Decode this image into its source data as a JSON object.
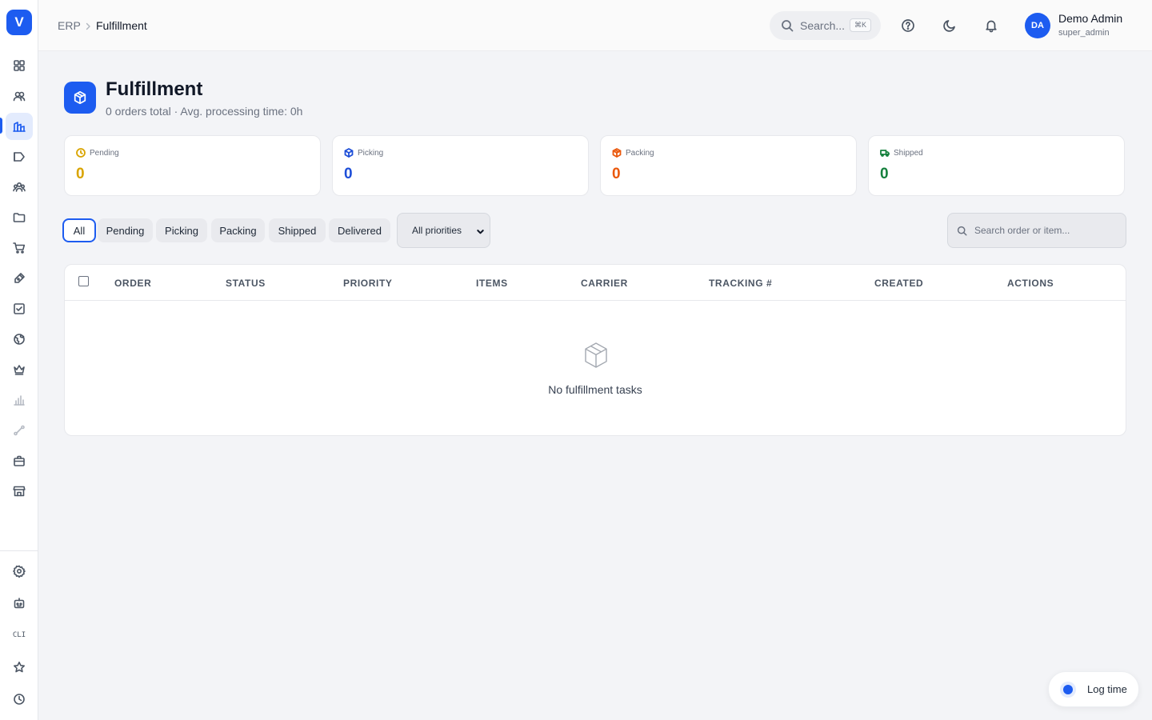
{
  "app": {
    "logo_letter": "V"
  },
  "breadcrumb": {
    "root": "ERP",
    "current": "Fulfillment"
  },
  "topbar": {
    "search_placeholder": "Search...",
    "search_shortcut": "⌘K",
    "user_initials": "DA",
    "user_name": "Demo Admin",
    "user_role": "super_admin"
  },
  "sidebar": {
    "items": [
      {
        "icon": "dashboard-icon"
      },
      {
        "icon": "contacts-icon"
      },
      {
        "icon": "erp-icon",
        "active": true
      },
      {
        "icon": "campaigns-icon"
      },
      {
        "icon": "team-icon"
      },
      {
        "icon": "folder-icon"
      },
      {
        "icon": "cart-icon"
      },
      {
        "icon": "pen-icon"
      },
      {
        "icon": "tasks-icon"
      },
      {
        "icon": "globe-icon"
      },
      {
        "icon": "crown-icon"
      },
      {
        "icon": "analytics-icon"
      },
      {
        "icon": "workflow-icon"
      },
      {
        "icon": "briefcase-icon"
      },
      {
        "icon": "store-icon"
      }
    ],
    "bottom": {
      "cli_label": "CLI"
    }
  },
  "page": {
    "title": "Fulfillment",
    "subtitle": "0 orders total · Avg. processing time: 0h"
  },
  "stats": [
    {
      "label": "Pending",
      "value": "0",
      "color": "#d9a400",
      "icon": "clock-icon"
    },
    {
      "label": "Picking",
      "value": "0",
      "color": "#1d4ed8",
      "icon": "box-icon"
    },
    {
      "label": "Packing",
      "value": "0",
      "color": "#ea580c",
      "icon": "package-icon"
    },
    {
      "label": "Shipped",
      "value": "0",
      "color": "#15803d",
      "icon": "truck-icon"
    }
  ],
  "filters": {
    "tabs": [
      "All",
      "Pending",
      "Picking",
      "Packing",
      "Shipped",
      "Delivered"
    ],
    "active_tab": "All",
    "priority_selected": "All priorities",
    "search_placeholder": "Search order or item..."
  },
  "table": {
    "columns": [
      "ORDER",
      "STATUS",
      "PRIORITY",
      "ITEMS",
      "CARRIER",
      "TRACKING #",
      "CREATED",
      "ACTIONS"
    ],
    "rows": [],
    "empty_text": "No fulfillment tasks"
  },
  "log_time": {
    "label": "Log time"
  },
  "colors": {
    "accent": "#1d5cf0"
  }
}
